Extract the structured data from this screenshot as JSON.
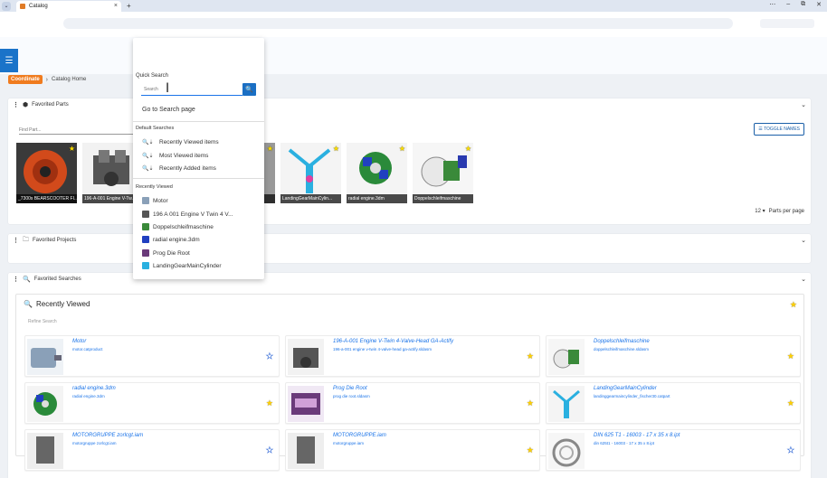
{
  "browser": {
    "tab_title": "Catalog",
    "close_glyph": "×",
    "new_tab_glyph": "+",
    "dropdown_glyph": "⌄",
    "controls": [
      "⋯",
      "–",
      "⧉",
      "✕"
    ]
  },
  "header": {
    "menu_glyph": "☰",
    "brand": "Coordinate",
    "breadcrumb_sep": "›",
    "breadcrumb": "Catalog Home"
  },
  "favorited_parts": {
    "title": "Favorited Parts",
    "find_placeholder": "Find Part...",
    "toggle_label": "☰ TOGGLE NAMES",
    "per_page_value": "12 ▾",
    "per_page_label": "Parts per page",
    "thumbs": [
      {
        "label": "_7300s BEARSCOOTER FI..."
      },
      {
        "label": "196-A-001 Engine V-Tw..."
      },
      {
        "label": ""
      },
      {
        "label": "...m"
      },
      {
        "label": "LandingGearMainCylin..."
      },
      {
        "label": "radial engine.3dm"
      },
      {
        "label": "Doppelschleifmaschine"
      }
    ],
    "icon": "cube-icon"
  },
  "favorited_projects": {
    "title": "Favorited Projects",
    "icon": "folder-icon"
  },
  "favorited_searches": {
    "title": "Favorited Searches",
    "icon": "search-icon",
    "recently_viewed_title": "Recently Viewed",
    "refine_label": "Refine Search",
    "cards": [
      {
        "name": "Motor",
        "file": "motor.catproduct",
        "starred": false
      },
      {
        "name": "196-A-001 Engine V-Twin 4-Valve-Head GA-Actify",
        "file": "196-a-001 engine v-twin 4-valve-head ga-actify.sldasm",
        "starred": true
      },
      {
        "name": "Doppelschleifmaschine",
        "file": "doppelschleifmaschine.sldasm",
        "starred": true
      },
      {
        "name": "radial engine.3dm",
        "file": "radial engine.3dm",
        "starred": true
      },
      {
        "name": "Prog Die Root",
        "file": "prog die root.sldasm",
        "starred": true
      },
      {
        "name": "LandingGearMainCylinder",
        "file": "landinggearmaincylinder_fischer30.catpart",
        "starred": true
      },
      {
        "name": "MOTORGRUPPE zorlcgt.iam",
        "file": "motorgruppe zorlcgt.iam",
        "starred": false
      },
      {
        "name": "MOTORGRUPPE.iam",
        "file": "motorgruppe.iam",
        "starred": true
      },
      {
        "name": "DIN 625 T1 - 16003 - 17 x 35 x 8.ipt",
        "file": "din 625t1 - 16003 - 17 x 35 x 8.ipt",
        "starred": false
      }
    ]
  },
  "quick_search": {
    "label": "Quick Search",
    "placeholder": "Search",
    "go_to_search": "Go to Search page",
    "default_title": "Default Searches",
    "default_items": [
      "Recently Viewed items",
      "Most Viewed items",
      "Recently Added items"
    ],
    "recent_title": "Recently Viewed",
    "recent_items": [
      "Motor",
      "196 A 001 Engine V Twin 4 V...",
      "Doppelschleifmaschine",
      "radial engine.3dm",
      "Prog Die Root",
      "LandingGearMainCylinder"
    ]
  },
  "colors": {
    "accent": "#1a73c9",
    "brand": "#f07b1e",
    "star": "#ffd000"
  }
}
